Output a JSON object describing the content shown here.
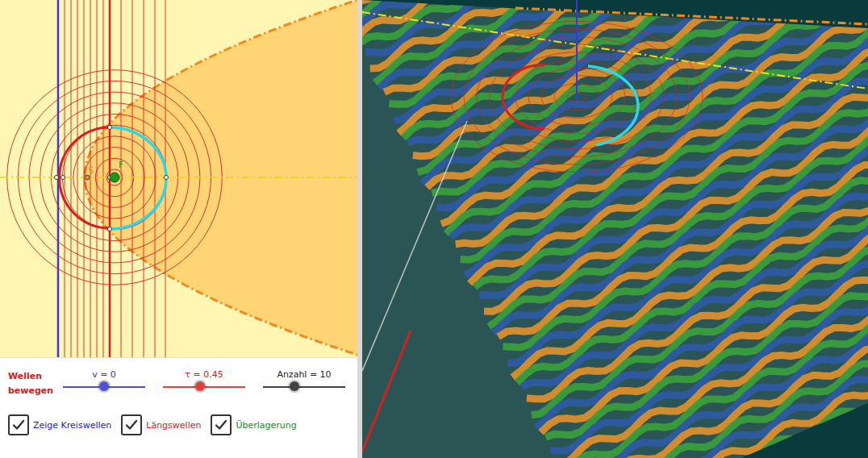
{
  "graphics": {
    "points": [
      {
        "label": "S",
        "color": "#e0901e"
      },
      {
        "label": "F",
        "color": "#1a9a1a"
      }
    ]
  },
  "animation_label": {
    "lines": [
      "Wellen",
      "bewegen"
    ],
    "color": "#d42020"
  },
  "sliders": [
    {
      "label": "v = 0",
      "level": 0.5,
      "color": "#3535c8"
    },
    {
      "label": "τ = 0.45",
      "level": 0.45,
      "color": "#d42020"
    },
    {
      "label": "Anzahl = 10",
      "level": 0.38,
      "color": "#222222"
    }
  ],
  "checkboxes": [
    {
      "label": "Zeige Kreiswellen",
      "checked": true,
      "color": "#1a1ad0"
    },
    {
      "label": "Längswellen",
      "checked": true,
      "color": "#d42020"
    },
    {
      "label": "Überlagerung",
      "checked": true,
      "color": "#1a8a1a"
    }
  ]
}
